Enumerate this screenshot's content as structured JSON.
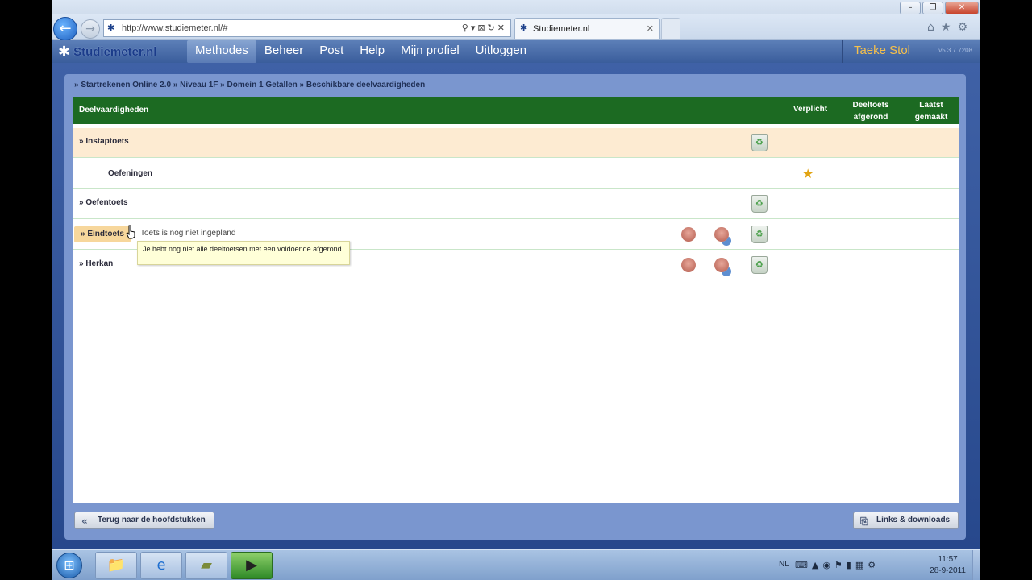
{
  "browser": {
    "url": "http://www.studiemeter.nl/#",
    "tab_title": "Studiemeter.nl",
    "window_buttons": [
      "–",
      "❐",
      "✕"
    ]
  },
  "site": {
    "brand": "Studiemeter.nl",
    "menu": [
      "Methodes",
      "Beheer",
      "Post",
      "Help",
      "Mijn profiel",
      "Uitloggen"
    ],
    "active_menu": "Methodes",
    "user": "Taeke Stol",
    "version": "v5.3.7.7208"
  },
  "breadcrumb": "» Startrekenen Online 2.0 » Niveau 1F » Domein 1 Getallen » Beschikbare deelvaardigheden",
  "table": {
    "headers": {
      "name": "Deelvaardigheden",
      "verplicht": "Verplicht",
      "deeltoets_l1": "Deeltoets",
      "deeltoets_l2": "afgerond",
      "laatst_l1": "Laatst",
      "laatst_l2": "gemaakt"
    },
    "rows": {
      "instaptoets": "» Instaptoets",
      "oefeningen": "Oefeningen",
      "oefentoets": "» Oefentoets",
      "eindtoets": "» Eindtoets",
      "eindtoets_note": "Toets is nog niet ingepland",
      "herkansing": "» Herkan"
    }
  },
  "tooltip": "Je hebt nog niet alle deeltoetsen met een voldoende afgerond.",
  "buttons": {
    "back": "Terug naar de hoofdstukken",
    "links": "Links & downloads"
  },
  "taskbar": {
    "language": "NL",
    "time": "11:57",
    "date": "28-9-2011"
  }
}
